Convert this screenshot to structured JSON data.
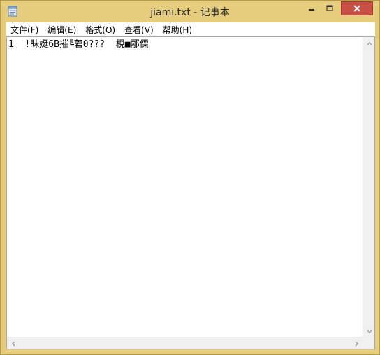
{
  "window": {
    "title": "jiami.txt - 记事本"
  },
  "menu": [
    {
      "label": "文件(",
      "accel": "F",
      "tail": ")"
    },
    {
      "label": "编辑(",
      "accel": "E",
      "tail": ")"
    },
    {
      "label": "格式(",
      "accel": "O",
      "tail": ")"
    },
    {
      "label": "查看(",
      "accel": "V",
      "tail": ")"
    },
    {
      "label": "帮助(",
      "accel": "H",
      "tail": ")"
    }
  ],
  "editor": {
    "content": "1  !眛娗6B摧╚菪0???  梘■邴傈"
  },
  "icons": {
    "app": "notepad-icon",
    "minimize": "minimize-icon",
    "maximize": "maximize-icon",
    "close": "close-icon"
  },
  "colors": {
    "frame": "#e6cd7e",
    "close_button": "#c74f45"
  }
}
